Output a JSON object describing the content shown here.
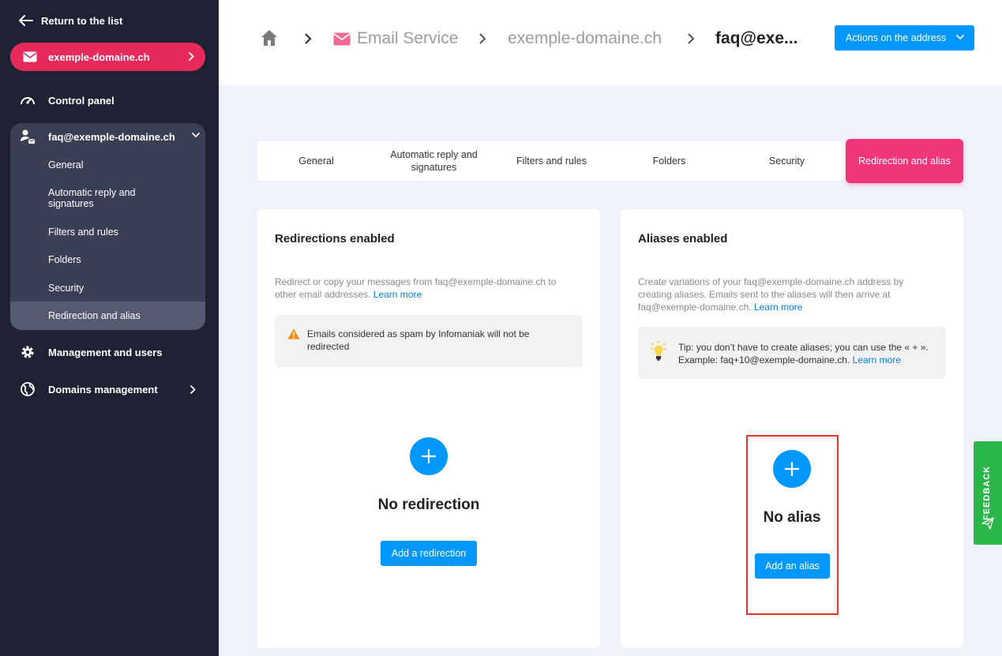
{
  "sidebar": {
    "back_label": "Return to the list",
    "domain": "exemple-domaine.ch",
    "control_panel": "Control panel",
    "account": "faq@exemple-domaine.ch",
    "sub_items": [
      "General",
      "Automatic reply and signatures",
      "Filters and rules",
      "Folders",
      "Security",
      "Redirection and alias"
    ],
    "management": "Management and users",
    "domains": "Domains management"
  },
  "header": {
    "crumbs": [
      "Email Service",
      "exemple-domaine.ch",
      "faq@exe..."
    ],
    "actions_label": "Actions on the address"
  },
  "tabs": [
    "General",
    "Automatic reply and signatures",
    "Filters and rules",
    "Folders",
    "Security",
    "Redirection and alias"
  ],
  "redirections": {
    "title": "Redirections enabled",
    "desc": "Redirect or copy your messages from faq@exemple-domaine.ch to other email addresses.",
    "learn_more": "Learn more",
    "notice": "Emails considered as spam by Infomaniak will not be redirected",
    "empty": "No redirection",
    "button": "Add a redirection"
  },
  "aliases": {
    "title": "Aliases enabled",
    "desc": "Create variations of your faq@exemple-domaine.ch address by creating aliases. Emails sent to the aliases will then arrive at faq@exemple-domaine.ch.",
    "learn_more": "Learn more",
    "tip": "Tip: you don’t have to create aliases; you can use the « + ». Example: faq+10@exemple-domaine.ch.",
    "tip_learn_more": "Learn more",
    "empty": "No alias",
    "button": "Add an alias"
  },
  "feedback_label": "FEEDBACK",
  "colors": {
    "sidebar_bg": "#1e2233",
    "accent_pink": "#e8295b",
    "tab_active": "#f1357a",
    "primary_blue": "#0098ff",
    "feedback_green": "#2bb64a",
    "highlight_red": "#e0352b"
  }
}
